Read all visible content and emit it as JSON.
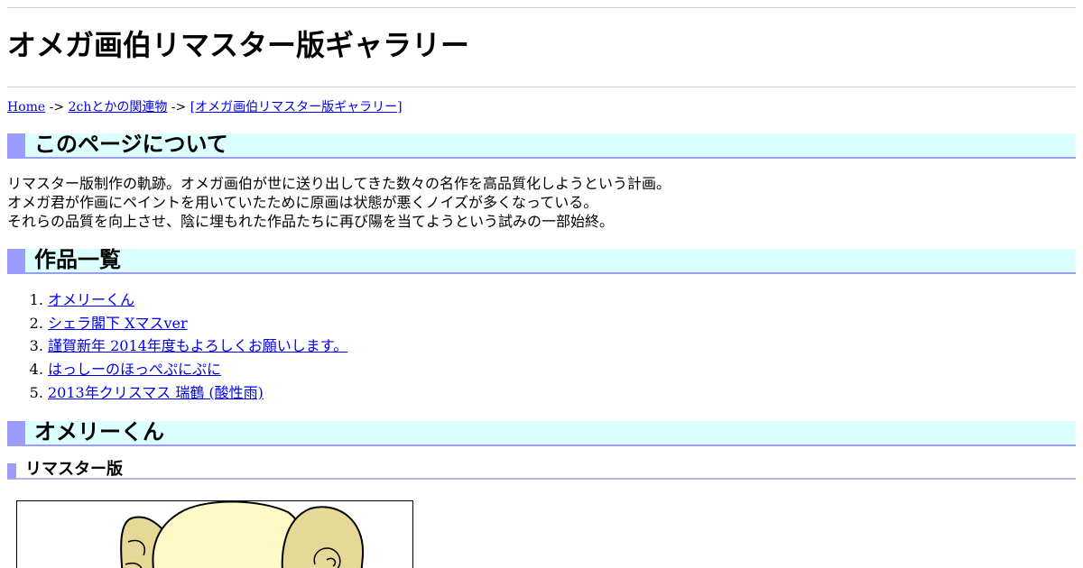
{
  "header": {
    "title": "オメガ画伯リマスター版ギャラリー"
  },
  "breadcrumb": {
    "home": "Home",
    "sep1": " -> ",
    "parent": "2chとかの関連物",
    "sep2": " -> ",
    "current": "[オメガ画伯リマスター版ギャラリー]"
  },
  "sections": {
    "about": {
      "heading": "このページについて",
      "lines": [
        "リマスター版制作の軌跡。オメガ画伯が世に送り出してきた数々の名作を高品質化しようという計画。",
        "オメガ君が作画にペイントを用いていたために原画は状態が悪くノイズが多くなっている。",
        "それらの品質を向上させ、陰に埋もれた作品たちに再び陽を当てようという試みの一部始終。"
      ]
    },
    "works": {
      "heading": "作品一覧",
      "items": [
        "オメリーくん",
        "シェラ閣下 Xマスver",
        "謹賀新年 2014年度もよろしくお願いします。",
        "はっしーのほっぺぷにぷに",
        "2013年クリスマス 瑞鶴 (酸性雨)"
      ]
    },
    "omeri": {
      "heading": "オメリーくん",
      "subheading": "リマスター版"
    }
  },
  "colors": {
    "heading_bg": "#dcffff",
    "heading_accent": "#9c9cff",
    "link": "#0000ee",
    "artwork_fill": "#fff9c8",
    "artwork_horn": "#e6d896"
  },
  "icons": {
    "artwork": "omeri-kun-illustration"
  }
}
